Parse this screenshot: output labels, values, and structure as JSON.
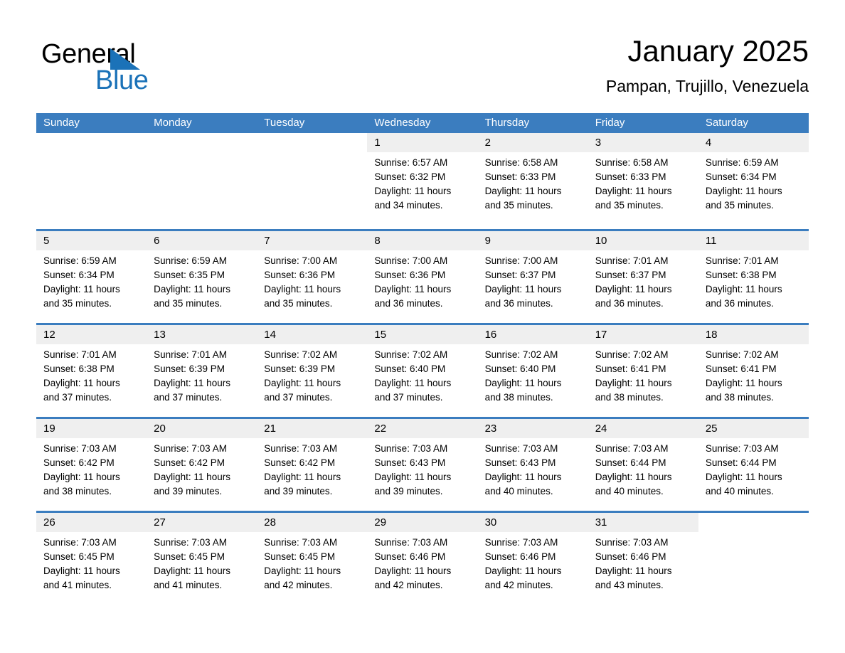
{
  "brand": {
    "name_part1": "General",
    "name_part2": "Blue",
    "triangle_icon": "brand-triangle-icon",
    "accent_color": "#1b72b8"
  },
  "header": {
    "title": "January 2025",
    "subtitle": "Pampan, Trujillo, Venezuela"
  },
  "colors": {
    "header_blue": "#3b7dbf",
    "date_band_gray": "#efefef",
    "text_black": "#000000",
    "text_white": "#ffffff"
  },
  "weekdays": [
    "Sunday",
    "Monday",
    "Tuesday",
    "Wednesday",
    "Thursday",
    "Friday",
    "Saturday"
  ],
  "weeks": [
    [
      {
        "day": "",
        "sunrise": "",
        "sunset": "",
        "daylight_line1": "",
        "daylight_line2": ""
      },
      {
        "day": "",
        "sunrise": "",
        "sunset": "",
        "daylight_line1": "",
        "daylight_line2": ""
      },
      {
        "day": "",
        "sunrise": "",
        "sunset": "",
        "daylight_line1": "",
        "daylight_line2": ""
      },
      {
        "day": "1",
        "sunrise": "Sunrise: 6:57 AM",
        "sunset": "Sunset: 6:32 PM",
        "daylight_line1": "Daylight: 11 hours",
        "daylight_line2": "and 34 minutes."
      },
      {
        "day": "2",
        "sunrise": "Sunrise: 6:58 AM",
        "sunset": "Sunset: 6:33 PM",
        "daylight_line1": "Daylight: 11 hours",
        "daylight_line2": "and 35 minutes."
      },
      {
        "day": "3",
        "sunrise": "Sunrise: 6:58 AM",
        "sunset": "Sunset: 6:33 PM",
        "daylight_line1": "Daylight: 11 hours",
        "daylight_line2": "and 35 minutes."
      },
      {
        "day": "4",
        "sunrise": "Sunrise: 6:59 AM",
        "sunset": "Sunset: 6:34 PM",
        "daylight_line1": "Daylight: 11 hours",
        "daylight_line2": "and 35 minutes."
      }
    ],
    [
      {
        "day": "5",
        "sunrise": "Sunrise: 6:59 AM",
        "sunset": "Sunset: 6:34 PM",
        "daylight_line1": "Daylight: 11 hours",
        "daylight_line2": "and 35 minutes."
      },
      {
        "day": "6",
        "sunrise": "Sunrise: 6:59 AM",
        "sunset": "Sunset: 6:35 PM",
        "daylight_line1": "Daylight: 11 hours",
        "daylight_line2": "and 35 minutes."
      },
      {
        "day": "7",
        "sunrise": "Sunrise: 7:00 AM",
        "sunset": "Sunset: 6:36 PM",
        "daylight_line1": "Daylight: 11 hours",
        "daylight_line2": "and 35 minutes."
      },
      {
        "day": "8",
        "sunrise": "Sunrise: 7:00 AM",
        "sunset": "Sunset: 6:36 PM",
        "daylight_line1": "Daylight: 11 hours",
        "daylight_line2": "and 36 minutes."
      },
      {
        "day": "9",
        "sunrise": "Sunrise: 7:00 AM",
        "sunset": "Sunset: 6:37 PM",
        "daylight_line1": "Daylight: 11 hours",
        "daylight_line2": "and 36 minutes."
      },
      {
        "day": "10",
        "sunrise": "Sunrise: 7:01 AM",
        "sunset": "Sunset: 6:37 PM",
        "daylight_line1": "Daylight: 11 hours",
        "daylight_line2": "and 36 minutes."
      },
      {
        "day": "11",
        "sunrise": "Sunrise: 7:01 AM",
        "sunset": "Sunset: 6:38 PM",
        "daylight_line1": "Daylight: 11 hours",
        "daylight_line2": "and 36 minutes."
      }
    ],
    [
      {
        "day": "12",
        "sunrise": "Sunrise: 7:01 AM",
        "sunset": "Sunset: 6:38 PM",
        "daylight_line1": "Daylight: 11 hours",
        "daylight_line2": "and 37 minutes."
      },
      {
        "day": "13",
        "sunrise": "Sunrise: 7:01 AM",
        "sunset": "Sunset: 6:39 PM",
        "daylight_line1": "Daylight: 11 hours",
        "daylight_line2": "and 37 minutes."
      },
      {
        "day": "14",
        "sunrise": "Sunrise: 7:02 AM",
        "sunset": "Sunset: 6:39 PM",
        "daylight_line1": "Daylight: 11 hours",
        "daylight_line2": "and 37 minutes."
      },
      {
        "day": "15",
        "sunrise": "Sunrise: 7:02 AM",
        "sunset": "Sunset: 6:40 PM",
        "daylight_line1": "Daylight: 11 hours",
        "daylight_line2": "and 37 minutes."
      },
      {
        "day": "16",
        "sunrise": "Sunrise: 7:02 AM",
        "sunset": "Sunset: 6:40 PM",
        "daylight_line1": "Daylight: 11 hours",
        "daylight_line2": "and 38 minutes."
      },
      {
        "day": "17",
        "sunrise": "Sunrise: 7:02 AM",
        "sunset": "Sunset: 6:41 PM",
        "daylight_line1": "Daylight: 11 hours",
        "daylight_line2": "and 38 minutes."
      },
      {
        "day": "18",
        "sunrise": "Sunrise: 7:02 AM",
        "sunset": "Sunset: 6:41 PM",
        "daylight_line1": "Daylight: 11 hours",
        "daylight_line2": "and 38 minutes."
      }
    ],
    [
      {
        "day": "19",
        "sunrise": "Sunrise: 7:03 AM",
        "sunset": "Sunset: 6:42 PM",
        "daylight_line1": "Daylight: 11 hours",
        "daylight_line2": "and 38 minutes."
      },
      {
        "day": "20",
        "sunrise": "Sunrise: 7:03 AM",
        "sunset": "Sunset: 6:42 PM",
        "daylight_line1": "Daylight: 11 hours",
        "daylight_line2": "and 39 minutes."
      },
      {
        "day": "21",
        "sunrise": "Sunrise: 7:03 AM",
        "sunset": "Sunset: 6:42 PM",
        "daylight_line1": "Daylight: 11 hours",
        "daylight_line2": "and 39 minutes."
      },
      {
        "day": "22",
        "sunrise": "Sunrise: 7:03 AM",
        "sunset": "Sunset: 6:43 PM",
        "daylight_line1": "Daylight: 11 hours",
        "daylight_line2": "and 39 minutes."
      },
      {
        "day": "23",
        "sunrise": "Sunrise: 7:03 AM",
        "sunset": "Sunset: 6:43 PM",
        "daylight_line1": "Daylight: 11 hours",
        "daylight_line2": "and 40 minutes."
      },
      {
        "day": "24",
        "sunrise": "Sunrise: 7:03 AM",
        "sunset": "Sunset: 6:44 PM",
        "daylight_line1": "Daylight: 11 hours",
        "daylight_line2": "and 40 minutes."
      },
      {
        "day": "25",
        "sunrise": "Sunrise: 7:03 AM",
        "sunset": "Sunset: 6:44 PM",
        "daylight_line1": "Daylight: 11 hours",
        "daylight_line2": "and 40 minutes."
      }
    ],
    [
      {
        "day": "26",
        "sunrise": "Sunrise: 7:03 AM",
        "sunset": "Sunset: 6:45 PM",
        "daylight_line1": "Daylight: 11 hours",
        "daylight_line2": "and 41 minutes."
      },
      {
        "day": "27",
        "sunrise": "Sunrise: 7:03 AM",
        "sunset": "Sunset: 6:45 PM",
        "daylight_line1": "Daylight: 11 hours",
        "daylight_line2": "and 41 minutes."
      },
      {
        "day": "28",
        "sunrise": "Sunrise: 7:03 AM",
        "sunset": "Sunset: 6:45 PM",
        "daylight_line1": "Daylight: 11 hours",
        "daylight_line2": "and 42 minutes."
      },
      {
        "day": "29",
        "sunrise": "Sunrise: 7:03 AM",
        "sunset": "Sunset: 6:46 PM",
        "daylight_line1": "Daylight: 11 hours",
        "daylight_line2": "and 42 minutes."
      },
      {
        "day": "30",
        "sunrise": "Sunrise: 7:03 AM",
        "sunset": "Sunset: 6:46 PM",
        "daylight_line1": "Daylight: 11 hours",
        "daylight_line2": "and 42 minutes."
      },
      {
        "day": "31",
        "sunrise": "Sunrise: 7:03 AM",
        "sunset": "Sunset: 6:46 PM",
        "daylight_line1": "Daylight: 11 hours",
        "daylight_line2": "and 43 minutes."
      },
      {
        "day": "",
        "sunrise": "",
        "sunset": "",
        "daylight_line1": "",
        "daylight_line2": ""
      }
    ]
  ]
}
